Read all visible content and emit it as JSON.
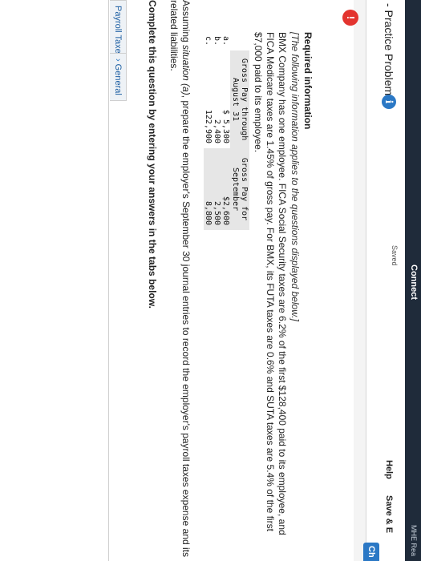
{
  "topbar": {
    "brand": "Connect",
    "mhe": "MHE Rea"
  },
  "header": {
    "title": "- Practice Problem",
    "info_glyph": "i",
    "saved": "Saved",
    "help": "Help",
    "save": "Save & E",
    "check": "Ch"
  },
  "alert_glyph": "!",
  "content": {
    "required_title": "Required information",
    "required_note": "[The following information applies to the questions displayed below.]",
    "description": "BMX Company has one employee. FICA Social Security taxes are 6.2% of the first $128,400 paid to its employee, and FICA Medicare taxes are 1.45% of gross pay. For BMX, its FUTA taxes are 0.6% and SUTA taxes are 5.4% of the first $7,000 paid to its employee.",
    "table": {
      "headers": [
        "Gross Pay through August 31",
        "Gross Pay for September"
      ],
      "rows": [
        {
          "label": "a.",
          "prefix": "$",
          "through": "5,300",
          "september": "$2,600"
        },
        {
          "label": "b.",
          "prefix": "",
          "through": "2,400",
          "september": "2,500"
        },
        {
          "label": "c.",
          "prefix": "",
          "through": "122,900",
          "september": "8,800"
        }
      ]
    },
    "question_pre": "Assuming ",
    "question_em": "situation (a)",
    "question_post": ", prepare the employer's September 30 journal entries to record the employer's payroll taxes expense and its related liabilities.",
    "instruction": "Complete this question by entering your answers in the tabs below."
  },
  "tabs": [
    {
      "label": "Payroll Taxes"
    },
    {
      "label": "General"
    }
  ]
}
